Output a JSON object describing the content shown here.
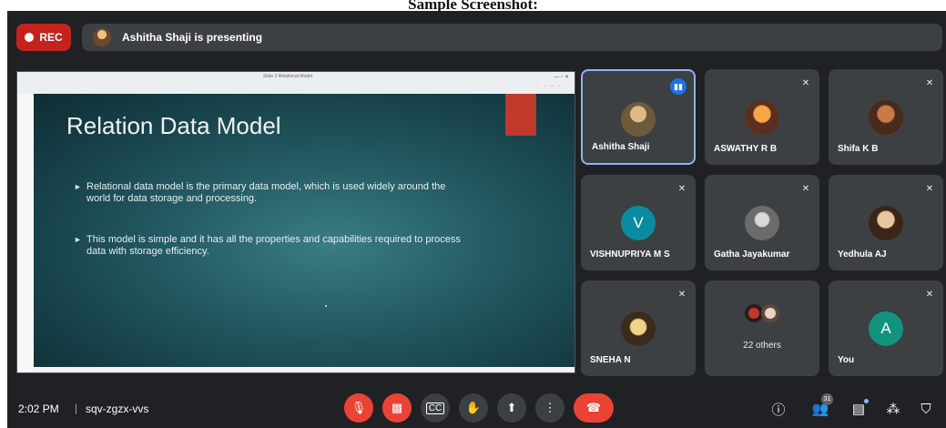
{
  "caption": "Sample Screenshot:",
  "top_bar": {
    "rec_label": "REC",
    "presenting_text": "Ashitha Shaji is presenting"
  },
  "shared_screen": {
    "browser_tab_title": "Slide 3 Relational Model",
    "slide": {
      "title": "Relation Data Model",
      "bullets": [
        "Relational data model is the primary data model, which is used widely around the world for data storage and processing.",
        "This model is simple and it has all the properties and capabilities required to process data with storage efficiency."
      ]
    }
  },
  "participants": [
    {
      "name": "Ashitha Shaji",
      "state": "speaking",
      "avatar": "photo"
    },
    {
      "name": "ASWATHY R B",
      "state": "muted",
      "avatar": "photo"
    },
    {
      "name": "Shifa K B",
      "state": "muted",
      "avatar": "photo"
    },
    {
      "name": "VISHNUPRIYA M S",
      "state": "muted",
      "avatar_letter": "V",
      "avatar_color": "#0b8ba0"
    },
    {
      "name": "Gatha Jayakumar",
      "state": "muted",
      "avatar": "photo"
    },
    {
      "name": "Yedhula AJ",
      "state": "muted",
      "avatar": "photo"
    },
    {
      "name": "SNEHA N",
      "state": "muted",
      "avatar": "photo"
    },
    {
      "others_label": "22 others"
    },
    {
      "name": "You",
      "state": "muted",
      "avatar_letter": "A",
      "avatar_color": "#12937d"
    }
  ],
  "bottom_bar": {
    "time": "2:02 PM",
    "separator": "|",
    "meeting_code": "sqv-zgzx-vvs",
    "participant_count": "31"
  },
  "icons": {
    "mic_off": "mic-off-icon",
    "cam_off": "camera-off-icon",
    "captions": "captions-icon",
    "raise_hand": "raise-hand-icon",
    "present": "present-icon",
    "more": "more-vert-icon",
    "hang_up": "hang-up-icon",
    "info": "info-icon",
    "people": "people-icon",
    "chat": "chat-icon",
    "activities": "activities-icon",
    "host_controls": "host-controls-icon"
  },
  "colors": {
    "background": "#202124",
    "tile": "#3c4043",
    "rec_red": "#c5221f",
    "hangup_red": "#ea4335",
    "active_border": "#8ab4f8"
  }
}
